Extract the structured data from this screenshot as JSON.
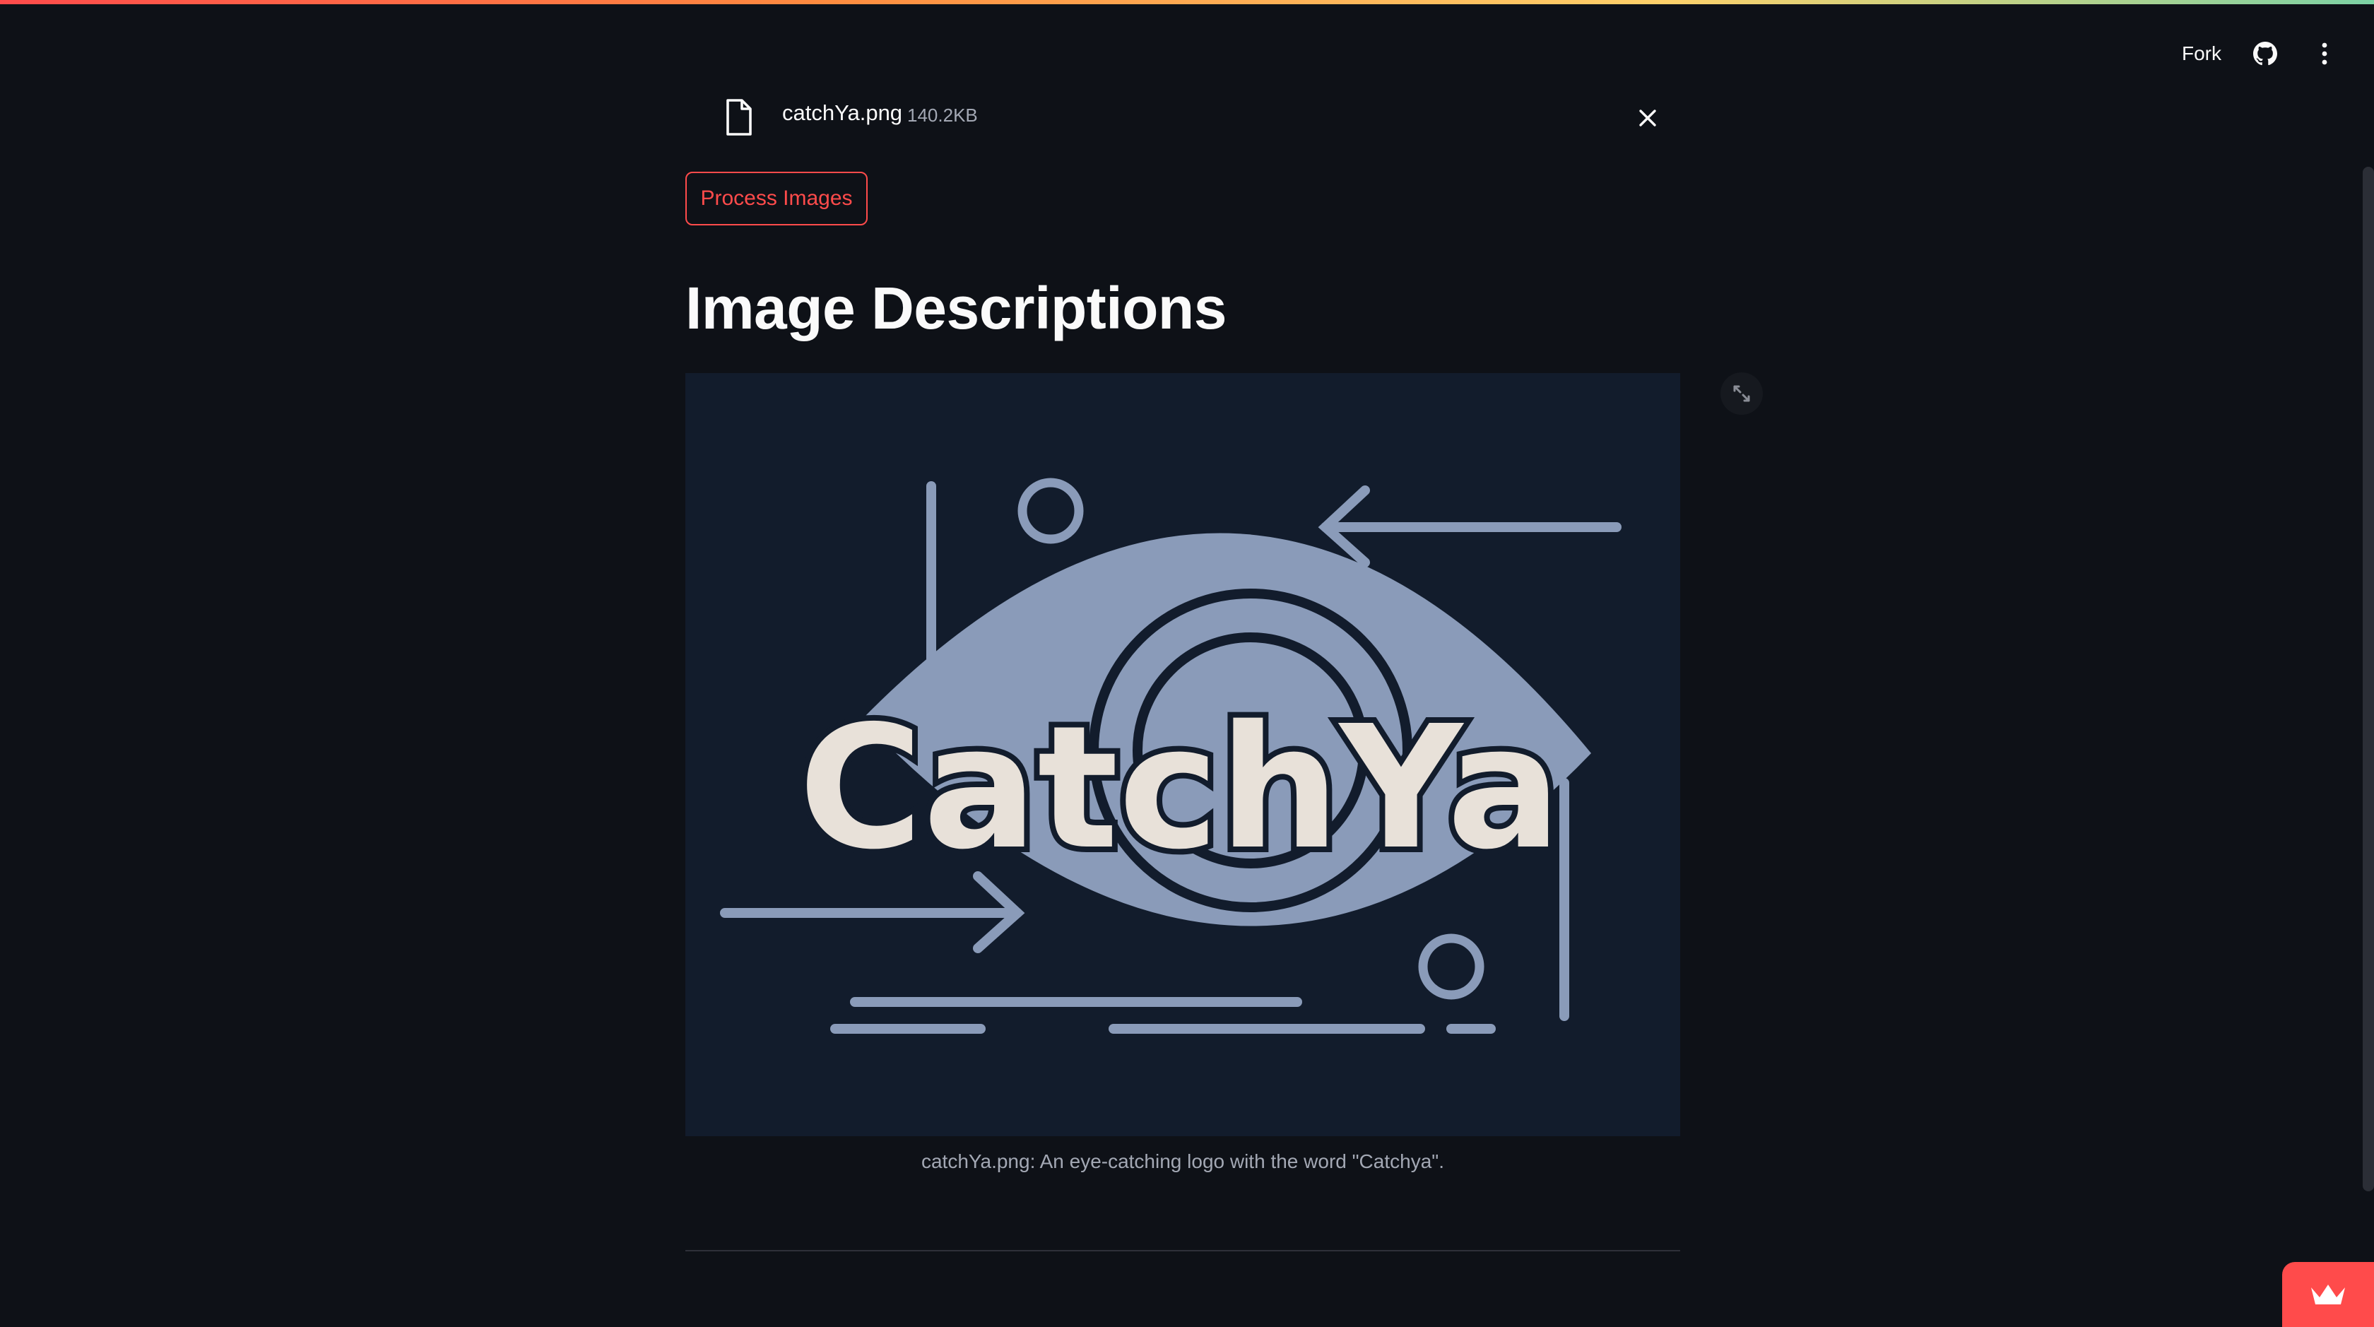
{
  "header": {
    "fork_label": "Fork",
    "github_icon": "github-icon",
    "menu_icon": "vertical-dots-icon"
  },
  "uploader": {
    "file_icon": "file-icon",
    "file_name": "catchYa.png",
    "file_size": "140.2KB",
    "remove_icon": "close-icon"
  },
  "actions": {
    "process_label": "Process Images"
  },
  "main": {
    "title": "Image Descriptions",
    "image": {
      "logo_text": "CatchYa",
      "caption": "catchYa.png: An eye-catching logo with the word \"Catchya\".",
      "expand_icon": "fullscreen-icon"
    }
  },
  "footer": {
    "badge_icon": "crown-icon"
  },
  "colors": {
    "background": "#0e1117",
    "accent": "#ff4b4b",
    "text": "#fafafa",
    "muted": "#a3a8b4",
    "logo_background": "#121c2c",
    "logo_lines": "#8a9bb9",
    "logo_text": "#e8e1d9"
  }
}
